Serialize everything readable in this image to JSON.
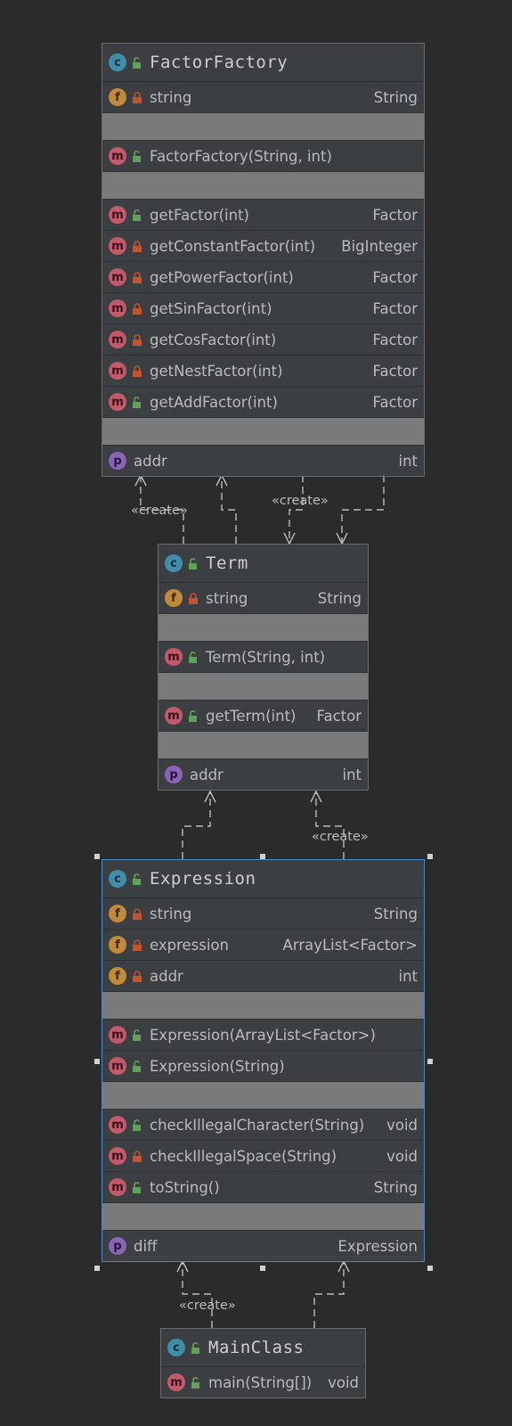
{
  "classes": {
    "factory": {
      "name": "FactorFactory",
      "fields": [
        {
          "name": "string",
          "type": "String"
        }
      ],
      "constructors": [
        {
          "name": "FactorFactory(String, int)",
          "type": ""
        }
      ],
      "methods": [
        {
          "name": "getFactor(int)",
          "type": "Factor"
        },
        {
          "name": "getConstantFactor(int)",
          "type": "BigInteger"
        },
        {
          "name": "getPowerFactor(int)",
          "type": "Factor"
        },
        {
          "name": "getSinFactor(int)",
          "type": "Factor"
        },
        {
          "name": "getCosFactor(int)",
          "type": "Factor"
        },
        {
          "name": "getNestFactor(int)",
          "type": "Factor"
        },
        {
          "name": "getAddFactor(int)",
          "type": "Factor"
        }
      ],
      "properties": [
        {
          "name": "addr",
          "type": "int"
        }
      ]
    },
    "term": {
      "name": "Term",
      "fields": [
        {
          "name": "string",
          "type": "String"
        }
      ],
      "constructors": [
        {
          "name": "Term(String, int)",
          "type": ""
        }
      ],
      "methods": [
        {
          "name": "getTerm(int)",
          "type": "Factor"
        }
      ],
      "properties": [
        {
          "name": "addr",
          "type": "int"
        }
      ]
    },
    "expression": {
      "name": "Expression",
      "fields": [
        {
          "name": "string",
          "type": "String"
        },
        {
          "name": "expression",
          "type": "ArrayList<Factor>"
        },
        {
          "name": "addr",
          "type": "int"
        }
      ],
      "constructors": [
        {
          "name": "Expression(ArrayList<Factor>)",
          "type": ""
        },
        {
          "name": "Expression(String)",
          "type": ""
        }
      ],
      "methods": [
        {
          "name": "checkIllegalCharacter(String)",
          "type": "void"
        },
        {
          "name": "checkIllegalSpace(String)",
          "type": "void"
        },
        {
          "name": "toString()",
          "type": "String"
        }
      ],
      "properties": [
        {
          "name": "diff",
          "type": "Expression"
        }
      ]
    },
    "main": {
      "name": "MainClass",
      "methods": [
        {
          "name": "main(String[])",
          "type": "void"
        }
      ]
    }
  },
  "badges": {
    "class": "c",
    "field": "f",
    "method": "m",
    "property": "p"
  },
  "edges": {
    "create_label": "«create»"
  },
  "colors": {
    "background": "#2b2b2b",
    "box": "#3c3f41",
    "separator": "#7a7a7a",
    "selected_border": "#4a88c7",
    "public_lock": "#5fa356",
    "private_lock": "#c5542e"
  }
}
